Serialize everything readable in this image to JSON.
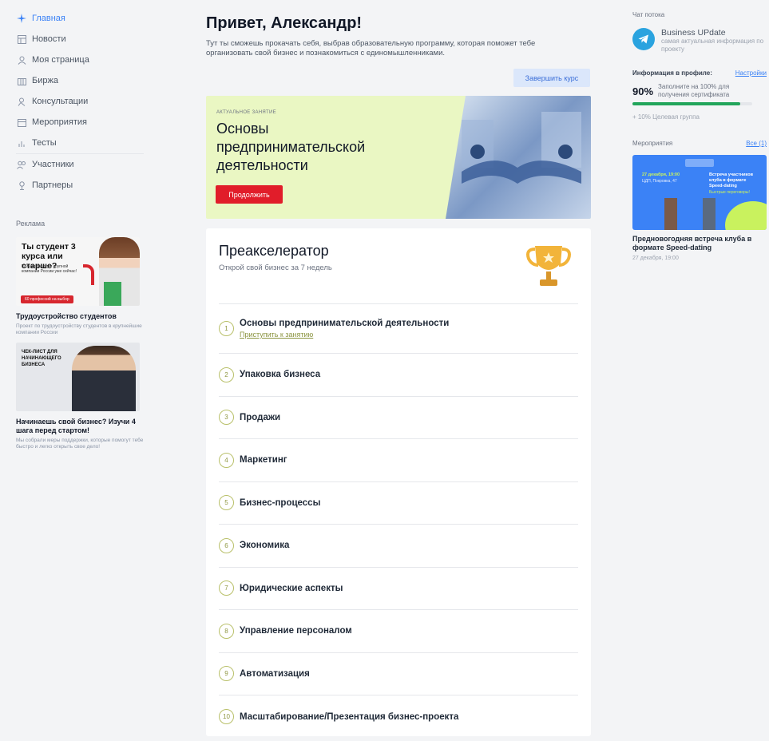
{
  "sidebar": {
    "items": [
      {
        "label": "Главная",
        "icon": "star-icon"
      },
      {
        "label": "Новости",
        "icon": "news-icon"
      },
      {
        "label": "Моя страница",
        "icon": "user-icon"
      },
      {
        "label": "Биржа",
        "icon": "exchange-icon"
      },
      {
        "label": "Консультации",
        "icon": "consult-icon"
      },
      {
        "label": "Мероприятия",
        "icon": "calendar-icon"
      },
      {
        "label": "Тесты",
        "icon": "bar-chart-icon"
      },
      {
        "label": "Участники",
        "icon": "users-icon"
      },
      {
        "label": "Партнеры",
        "icon": "partner-icon"
      }
    ],
    "ads_title": "Реклама",
    "ads": [
      {
        "image_headline": "Ты студент 3 курса или старше?",
        "image_text": "Получи работу в крупной компании России уже сейчас!",
        "image_badge": "60 профессий на выбор",
        "title": "Трудоустройство студентов",
        "description": "Проект по трудоустройству студентов в крупнейшие компании России"
      },
      {
        "image_headline": "ЧЕК-ЛИСТ ДЛЯ НАЧИНАЮЩЕГО БИЗНЕСА",
        "title": "Начинаешь свой бизнес? Изучи 4 шага перед стартом!",
        "description": "Мы собрали меры поддержки, которые помогут тебе быстро и легко открыть свое дело!"
      }
    ]
  },
  "main": {
    "greeting": "Привет, Александр!",
    "intro": "Тут ты сможешь прокачать себя, выбрав образовательную программу, которая поможет тебе организовать свой бизнес и познакомиться с единомышленниками.",
    "finish_button": "Завершить курс",
    "current_lesson": {
      "label": "АКТУАЛЬНОЕ ЗАНЯТИЕ",
      "title": "Основы предпринимательской деятельности",
      "button": "Продолжить"
    },
    "program": {
      "title": "Преакселератор",
      "subtitle": "Открой свой бизнес за 7 недель",
      "start_link": "Приступить к занятию",
      "modules": [
        {
          "num": "1",
          "name": "Основы предпринимательской деятельности"
        },
        {
          "num": "2",
          "name": "Упаковка бизнеса"
        },
        {
          "num": "3",
          "name": "Продажи"
        },
        {
          "num": "4",
          "name": "Маркетинг"
        },
        {
          "num": "5",
          "name": "Бизнес-процессы"
        },
        {
          "num": "6",
          "name": "Экономика"
        },
        {
          "num": "7",
          "name": "Юридические аспекты"
        },
        {
          "num": "8",
          "name": "Управление персоналом"
        },
        {
          "num": "9",
          "name": "Автоматизация"
        },
        {
          "num": "10",
          "name": "Масштабирование/Презентация бизнес-проекта"
        }
      ]
    }
  },
  "right": {
    "chat_heading": "Чат потока",
    "chat_name": "Business UPdate",
    "chat_desc": "самая актуальная информация по проекту",
    "profile_heading": "Информация в профиле:",
    "settings_link": "Настройки",
    "profile_percent": "90%",
    "profile_progress": 0.9,
    "profile_hint": "Заполните на 100% для получения сертификата",
    "extra_item": "+ 10%  Целевая группа",
    "events_heading": "Мероприятия",
    "events_all": "Все (1)",
    "event": {
      "image_date": "27 декабря, 19:00",
      "image_place": "ЦДП, Покровка, 47",
      "image_title": "Встреча участников клуба в формате Speed-dating",
      "image_sub": "Быстрые переговоры!",
      "title": "Предновогодняя встреча клуба в формате Speed-dating",
      "date": "27 декабря, 19:00"
    }
  },
  "colors": {
    "accent": "#3b82f6",
    "red_button": "#e11d2a",
    "lesson_bg": "#eaf7c3",
    "progress": "#22a55b"
  }
}
